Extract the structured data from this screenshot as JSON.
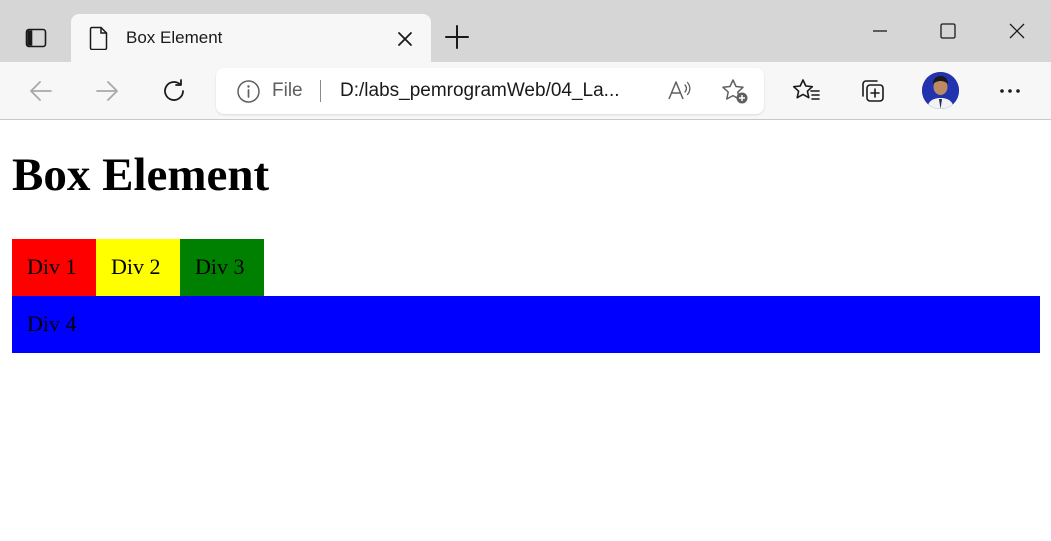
{
  "browser": {
    "tab": {
      "title": "Box Element"
    },
    "address_bar": {
      "scheme_label": "File",
      "url": "D:/labs_pemrogramWeb/04_La..."
    },
    "icons": {
      "tab_actions": "tab-actions-icon",
      "page": "page-icon",
      "close_tab": "close-icon",
      "new_tab": "plus-icon",
      "minimize": "minimize-icon",
      "maximize": "maximize-icon",
      "close_window": "close-icon",
      "back": "back-arrow-icon",
      "forward": "forward-arrow-icon",
      "reload": "reload-icon",
      "info": "info-icon",
      "read_aloud": "read-aloud-icon",
      "add_favorite": "add-favorite-icon",
      "favorites": "favorites-icon",
      "collections": "collections-icon",
      "more": "more-icon"
    }
  },
  "page": {
    "heading": "Box Element",
    "boxes": [
      {
        "label": "Div 1",
        "color": "#ff0000"
      },
      {
        "label": "Div 2",
        "color": "#ffff00"
      },
      {
        "label": "Div 3",
        "color": "#008000"
      },
      {
        "label": "Div 4",
        "color": "#0000ff"
      }
    ]
  }
}
